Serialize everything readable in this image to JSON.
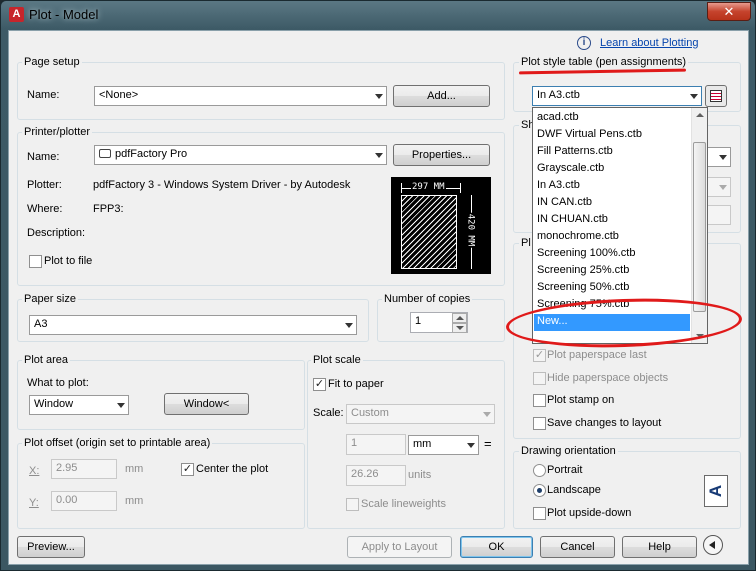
{
  "window": {
    "title": "Plot - Model",
    "app_icon": "A",
    "close_label": "✕"
  },
  "help": {
    "link": "Learn about Plotting",
    "icon": "info-icon"
  },
  "page_setup": {
    "group_title": "Page setup",
    "name_label": "Name:",
    "name_value": "<None>",
    "add_button": "Add..."
  },
  "printer": {
    "group_title": "Printer/plotter",
    "name_label": "Name:",
    "name_value": "pdfFactory Pro",
    "properties_button": "Properties...",
    "plotter_label": "Plotter:",
    "plotter_value": "pdfFactory 3 - Windows System Driver - by Autodesk",
    "where_label": "Where:",
    "where_value": "FPP3:",
    "description_label": "Description:",
    "plot_to_file": "Plot to file",
    "preview_width": "297 MM",
    "preview_height": "420 MM"
  },
  "paper_size": {
    "group_title": "Paper size",
    "value": "A3"
  },
  "copies": {
    "label": "Number of copies",
    "value": "1"
  },
  "plot_area": {
    "group_title": "Plot area",
    "what_label": "What to plot:",
    "value": "Window",
    "window_button": "Window<"
  },
  "plot_offset": {
    "group_title": "Plot offset (origin set to printable area)",
    "x_label": "X:",
    "x_value": "2.95",
    "x_unit": "mm",
    "y_label": "Y:",
    "y_value": "0.00",
    "y_unit": "mm",
    "center_label": "Center the plot"
  },
  "plot_scale": {
    "group_title": "Plot scale",
    "fit_label": "Fit to paper",
    "scale_label": "Scale:",
    "scale_value": "Custom",
    "value1": "1",
    "unit": "mm",
    "equals": "=",
    "value2": "26.26",
    "units_label": "units",
    "lineweights_label": "Scale lineweights"
  },
  "plot_style": {
    "group_title": "Plot style table (pen assignments)",
    "value": "In A3.ctb",
    "list": [
      "acad.ctb",
      "DWF Virtual Pens.ctb",
      "Fill Patterns.ctb",
      "Grayscale.ctb",
      "In A3.ctb",
      "IN CAN.ctb",
      "IN CHUAN.ctb",
      "monochrome.ctb",
      "Screening 100%.ctb",
      "Screening 25%.ctb",
      "Screening 50%.ctb",
      "Screening 75%.ctb",
      "New..."
    ],
    "partial_label_sh": "Sh",
    "partial_label_pl": "Pl"
  },
  "plot_options": {
    "paperspace_last": "Plot paperspace last",
    "hide_paperspace": "Hide paperspace objects",
    "plot_stamp": "Plot stamp on",
    "save_changes": "Save changes to layout"
  },
  "orientation": {
    "group_title": "Drawing orientation",
    "portrait": "Portrait",
    "landscape": "Landscape",
    "upside_down": "Plot upside-down",
    "icon_letter": "A"
  },
  "footer": {
    "preview": "Preview...",
    "apply": "Apply to Layout",
    "ok": "OK",
    "cancel": "Cancel",
    "help": "Help"
  },
  "colors": {
    "highlight": "#3399ff",
    "annotation": "#e01a1a"
  }
}
